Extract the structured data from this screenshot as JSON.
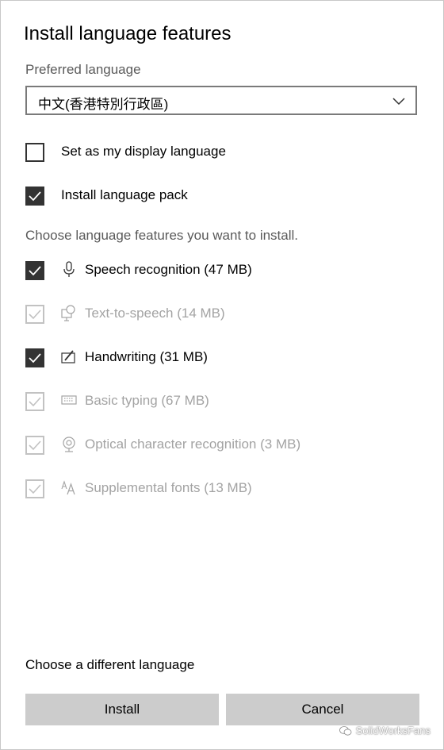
{
  "dialog": {
    "title": "Install language features",
    "preferred_language_label": "Preferred language",
    "preferred_language_value": "中文(香港特別行政區)",
    "options": [
      {
        "label": "Set as my display language",
        "checked": false
      },
      {
        "label": "Install language pack",
        "checked": true
      }
    ],
    "features_heading": "Choose language features you want to install.",
    "features": [
      {
        "label": "Speech recognition (47 MB)",
        "icon": "microphone-icon",
        "checked": true,
        "enabled": true
      },
      {
        "label": "Text-to-speech (14 MB)",
        "icon": "speech-bubble-icon",
        "checked": true,
        "enabled": false
      },
      {
        "label": "Handwriting (31 MB)",
        "icon": "pen-icon",
        "checked": true,
        "enabled": true
      },
      {
        "label": "Basic typing (67 MB)",
        "icon": "keyboard-icon",
        "checked": true,
        "enabled": false
      },
      {
        "label": "Optical character recognition (3 MB)",
        "icon": "camera-icon",
        "checked": true,
        "enabled": false
      },
      {
        "label": "Supplemental fonts (13 MB)",
        "icon": "font-icon",
        "checked": true,
        "enabled": false
      }
    ],
    "different_language_link": "Choose a different language",
    "install_button": "Install",
    "cancel_button": "Cancel"
  },
  "watermark": "SolidWorksFans",
  "colors": {
    "checked_fill": "#333333",
    "disabled_text": "#a3a3a3",
    "button_bg": "#cccccc"
  }
}
